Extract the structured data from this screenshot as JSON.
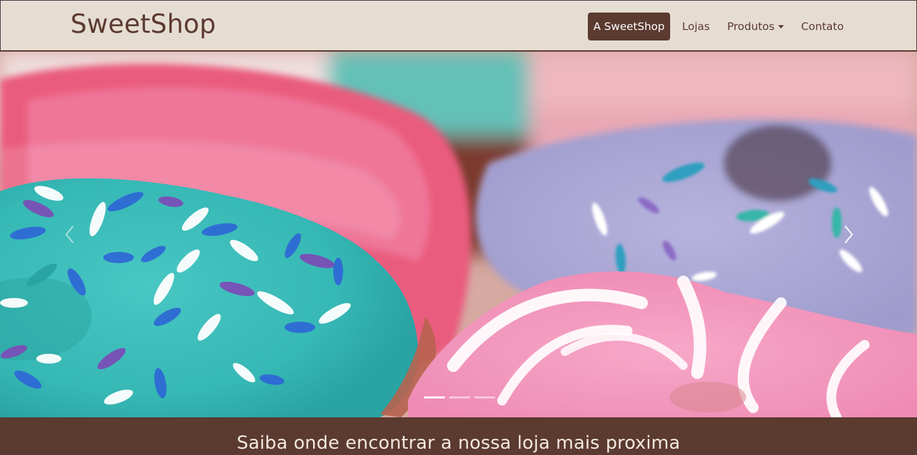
{
  "brand": {
    "name": "SweetShop"
  },
  "nav": {
    "items": [
      {
        "label": "A SweetShop",
        "active": true
      },
      {
        "label": "Lojas",
        "active": false
      },
      {
        "label": "Produtos",
        "active": false,
        "dropdown": true
      },
      {
        "label": "Contato",
        "active": false
      }
    ]
  },
  "carousel": {
    "active_slide": 1,
    "slide_count": 3,
    "prev_icon": "chevron-left-icon",
    "next_icon": "chevron-right-icon"
  },
  "section": {
    "title": "Saiba onde encontrar a nossa loja mais proxima"
  },
  "colors": {
    "brand_brown": "#5b3a2f",
    "nav_bg": "#e6ddd2",
    "text_light": "#f2e8df"
  }
}
